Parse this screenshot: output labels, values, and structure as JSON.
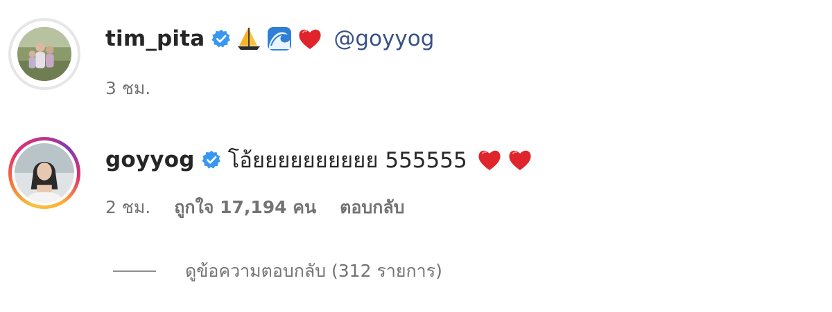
{
  "comments": [
    {
      "username": "tim_pita",
      "verified": true,
      "emojis": [
        "sailboat-emoji",
        "wave-emoji",
        "red-heart-emoji"
      ],
      "mention": "@goyyog",
      "time": "3 ชม.",
      "avatar_ring": "none"
    },
    {
      "username": "goyyog",
      "verified": true,
      "text": "โอ้ยยยยยยยยยย 555555",
      "emojis": [
        "red-heart-emoji",
        "red-heart-emoji"
      ],
      "time": "2 ชม.",
      "likes": "ถูกใจ 17,194 คน",
      "reply_label": "ตอบกลับ",
      "avatar_ring": "story-gradient"
    }
  ],
  "view_replies": "ดูข้อความตอบกลับ (312 รายการ)",
  "colors": {
    "text": "#262626",
    "meta": "#737373",
    "mention": "#385185",
    "verified": "#3897f0",
    "heart": "#e0242c"
  }
}
